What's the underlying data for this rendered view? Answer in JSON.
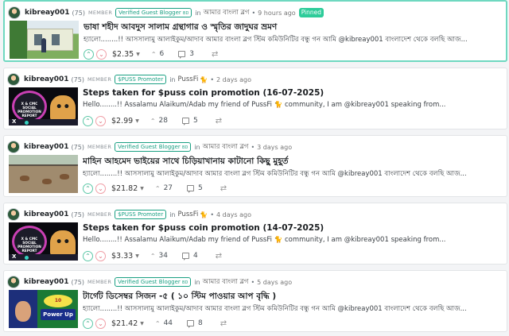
{
  "posts": [
    {
      "author": "kibreay001",
      "reputation": "(75)",
      "role": "MEMBER",
      "badge": "Verified Guest Blogger",
      "badge_suffix": "BD",
      "in_label": "in",
      "community": "আমার বাংলা ব্লগ",
      "time": "9 hours ago",
      "pinned_label": "Pinned",
      "title": "ভাষা শহীদ আবদুস সালাম গ্রন্থাগার ও স্মৃতির জাদুঘর ভ্রমণ",
      "summary": "হ্যালো........!! আসসালামু আলাইকুম/আদাব আমার বাংলা ব্লগ স্টিম কমিউনিটির বন্ধু গন আমি @kibreay001 বাংলাদেশ থেকে বলছি আজ...",
      "payout": "$2.35",
      "votes": "6",
      "comments": "3",
      "thumb_icon": "library-building-photo"
    },
    {
      "author": "kibreay001",
      "reputation": "(75)",
      "role": "MEMBER",
      "badge": "$PUSS Promoter",
      "badge_suffix": "",
      "in_label": "in",
      "community": "PussFi",
      "community_icon": "🐈",
      "time": "2 days ago",
      "title": "Steps taken for $puss coin promotion (16-07-2025)",
      "summary": "Hello........!! Assalamu Alaikum/Adab my friend of PussFi 🐈 community, I am @kibreay001 speaking from...",
      "payout": "$2.99",
      "votes": "28",
      "comments": "5",
      "thumb_text": "X & CMC SOCIAL PROMOTION REPORT"
    },
    {
      "author": "kibreay001",
      "reputation": "(75)",
      "role": "MEMBER",
      "badge": "Verified Guest Blogger",
      "badge_suffix": "BD",
      "in_label": "in",
      "community": "আমার বাংলা ব্লগ",
      "time": "3 days ago",
      "title": "মাহিন আহমেদ ভাইয়ের সাথে চিড়িয়াখানায় কাটানো কিছু মুহূর্ত",
      "summary": "হ্যালো........!! আসসালামু আলাইকুম/আদাব আমার বাংলা ব্লগ স্টিম কমিউনিটির বন্ধু গন আমি @kibreay001 বাংলাদেশ থেকে বলছি আজ...",
      "payout": "$21.82",
      "votes": "27",
      "comments": "5",
      "thumb_icon": "zoo-deer-photo"
    },
    {
      "author": "kibreay001",
      "reputation": "(75)",
      "role": "MEMBER",
      "badge": "$PUSS Promoter",
      "badge_suffix": "",
      "in_label": "in",
      "community": "PussFi",
      "community_icon": "🐈",
      "time": "4 days ago",
      "title": "Steps taken for $puss coin promotion (14-07-2025)",
      "summary": "Hello........!! Assalamu Alaikum/Adab my friend of PussFi 🐈 community, I am @kibreay001 speaking from...",
      "payout": "$3.33",
      "votes": "34",
      "comments": "4",
      "thumb_text": "X & CMC SOCIAL PROMOTION REPORT"
    },
    {
      "author": "kibreay001",
      "reputation": "(75)",
      "role": "MEMBER",
      "badge": "Verified Guest Blogger",
      "badge_suffix": "BD",
      "in_label": "in",
      "community": "আমার বাংলা ব্লগ",
      "time": "5 days ago",
      "title": "টার্গেট ডিসেম্বর সিজন -৫ ( ১০ স্টিম পাওয়ার আপ বৃদ্ধি )",
      "summary": "হ্যালো........!! আসসালামু আলাইকুম/আদাব আমার বাংলা ব্লগ স্টিম কমিউনিটির বন্ধু গন আমি @kibreay001 বাংলাদেশ থেকে বলছি আজ...",
      "payout": "$21.42",
      "votes": "44",
      "comments": "8",
      "thumb_text": "Power Up"
    }
  ],
  "colors": {
    "accent": "#1aa083",
    "pinned_border": "#6fd8c0",
    "pinned_badge": "#2ecc9a",
    "upvote": "#3aa785",
    "downvote": "#e0707c"
  }
}
